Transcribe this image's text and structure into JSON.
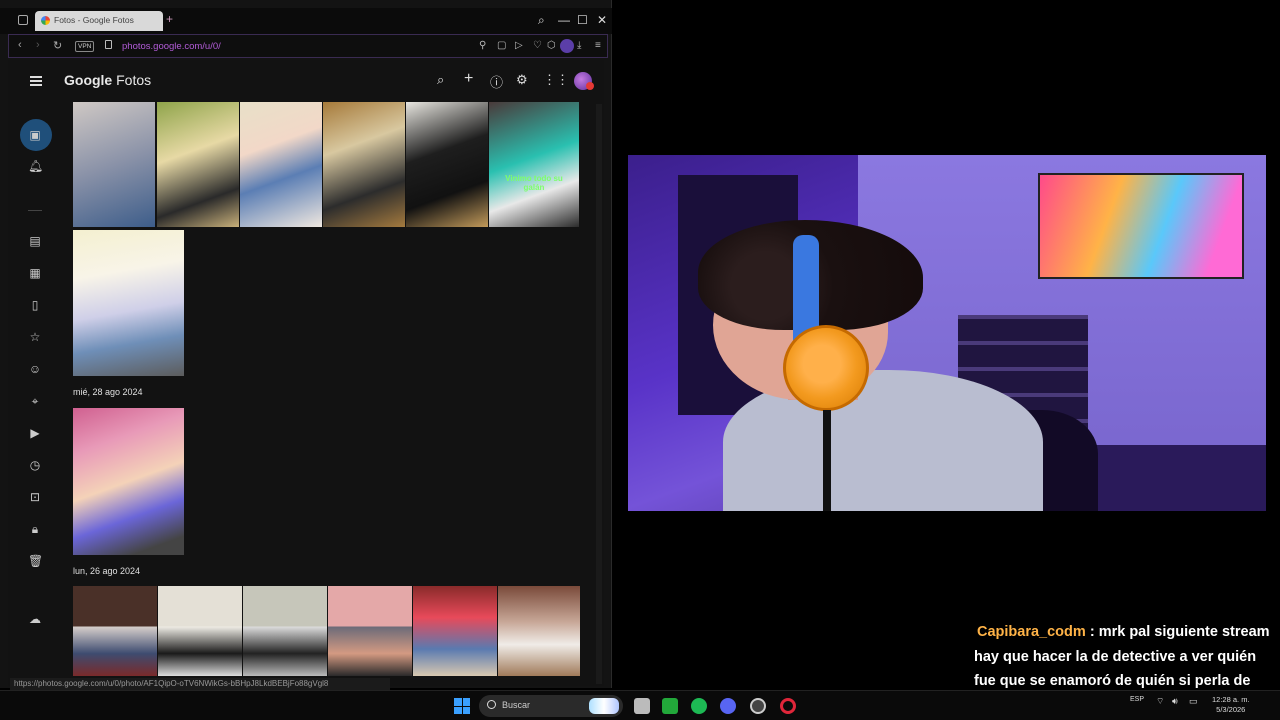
{
  "browser": {
    "tab_title": "Fotos - Google Fotos",
    "new_tab_symbol": "+",
    "vpn_label": "VPN",
    "url": "photos.google.com/u/0/",
    "status_link": "https://photos.google.com/u/0/photo/AF1QipO-oTV6NWikGs-bBHpJ8LkdBEBjFo88gVgl8"
  },
  "photos_app": {
    "brand_google": "Google",
    "brand_fotos": "Fotos",
    "groups": [
      {
        "date": ""
      },
      {
        "date": "mié, 28 ago 2024"
      },
      {
        "date": "lun, 26 ago 2024"
      }
    ],
    "photo_caption": "Vinimo todo su galán",
    "icons": {
      "search": "search-icon",
      "add": "plus-icon",
      "help": "help-icon",
      "settings": "gear-icon",
      "apps": "apps-grid-icon"
    },
    "accent_active": "#1f4f7a"
  },
  "chat": {
    "username": "Capibara_codm",
    "separator": " : ",
    "message": "mrk pal siguiente stream hay que hacer la de detective a ver quién fue que se enamoró de quién si perla de Ricardo o al revés"
  },
  "taskbar": {
    "search_placeholder": "Buscar",
    "language": "ESP",
    "time": "12:28 a. m.",
    "date": "5/3/2026"
  },
  "colors": {
    "url": "#b35cd8",
    "chat_username": "#ffb347",
    "browser_bg": "#131313"
  }
}
